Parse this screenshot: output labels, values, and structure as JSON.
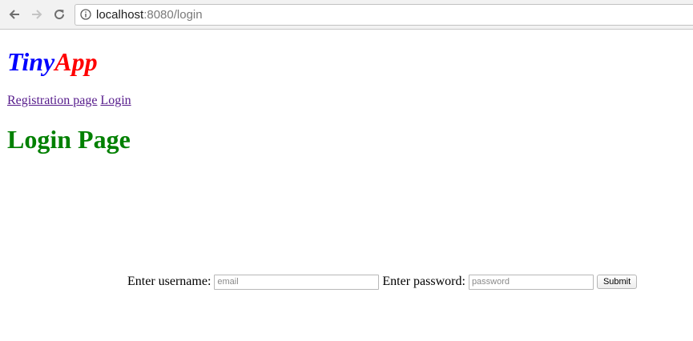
{
  "browser": {
    "url_host": "localhost",
    "url_rest": ":8080/login",
    "icons": {
      "back": "arrow-left-icon",
      "forward": "arrow-right-icon",
      "reload": "reload-icon",
      "info": "info-icon"
    }
  },
  "header": {
    "brand_part1": "Tiny",
    "brand_part2": "App",
    "brand_colors": {
      "part1": "#0000ff",
      "part2": "#ff0000"
    }
  },
  "nav": {
    "links": [
      {
        "label": "Registration page"
      },
      {
        "label": "Login"
      }
    ],
    "link_color": "#551a8b"
  },
  "main": {
    "title": "Login Page",
    "title_color": "#008000"
  },
  "form": {
    "username_label": "Enter username:",
    "username_placeholder": "email",
    "password_label": "Enter password:",
    "password_placeholder": "password",
    "submit_label": "Submit"
  }
}
